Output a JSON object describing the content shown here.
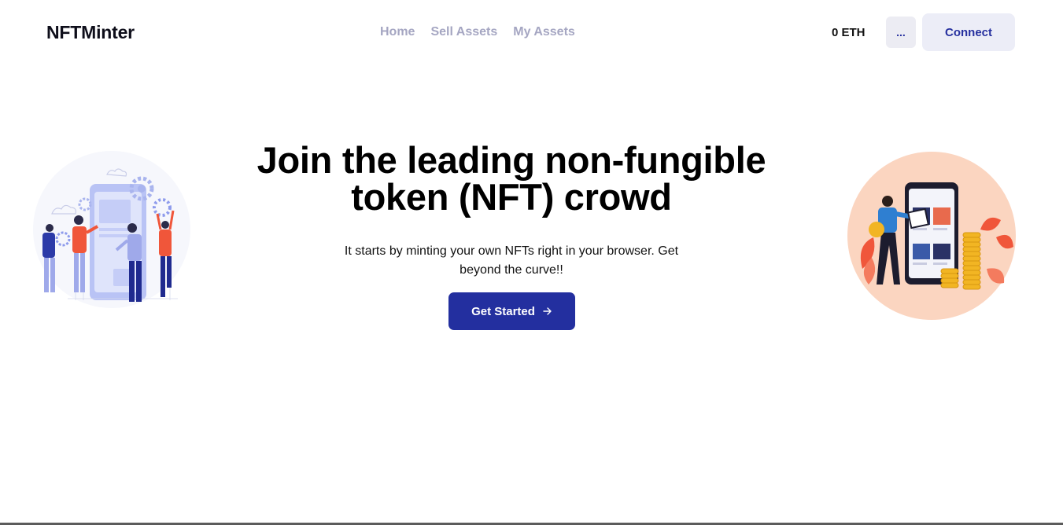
{
  "navbar": {
    "brand": "NFTMinter",
    "links": [
      {
        "label": "Home"
      },
      {
        "label": "Sell Assets"
      },
      {
        "label": "My Assets"
      }
    ],
    "balance": "0 ETH",
    "more_label": "...",
    "connect_label": "Connect"
  },
  "hero": {
    "title": "Join the leading non-fungible token (NFT) crowd",
    "subtitle": "It starts by minting your own NFTs right in your browser. Get beyond the curve!!",
    "cta_label": "Get Started",
    "cta_icon": "arrow-right-icon"
  },
  "illustrations": {
    "left": "team-building-app-illustration",
    "right": "nft-marketplace-phone-coins-illustration"
  },
  "colors": {
    "primary": "#232f9f",
    "nav_link": "#a5a6c2",
    "button_light": "#ecedf7",
    "right_circle": "#fbd5c0",
    "accent_orange": "#f0563a",
    "coin_gold": "#f2b523",
    "left_illustration_blue": "#8e9bec"
  }
}
